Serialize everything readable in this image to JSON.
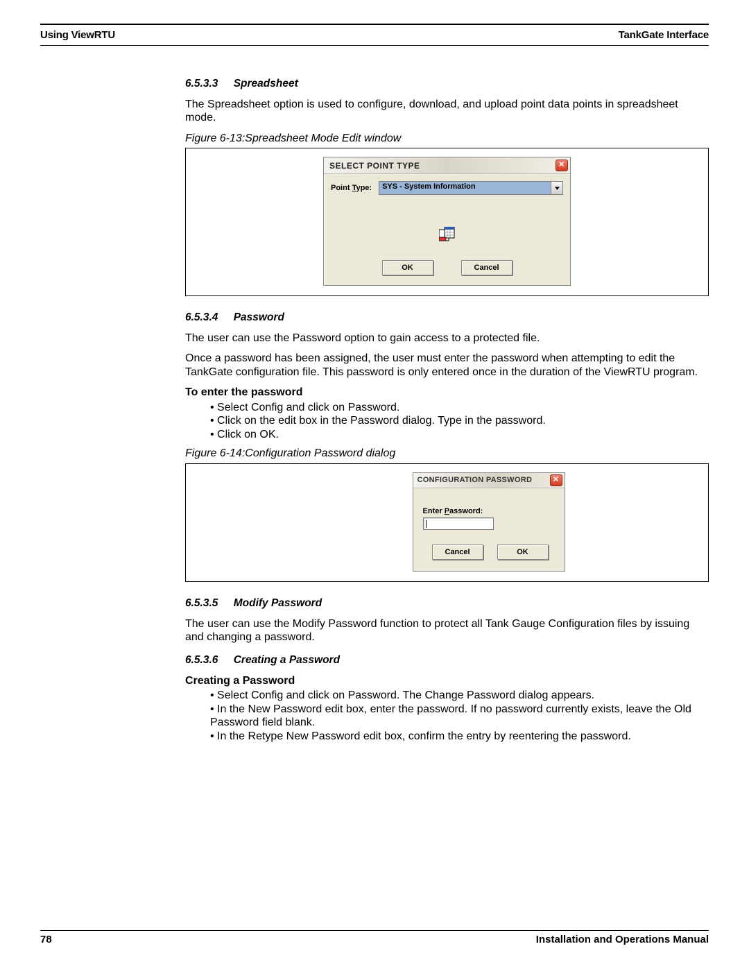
{
  "header": {
    "left": "Using ViewRTU",
    "right": "TankGate Interface"
  },
  "s6533": {
    "num": "6.5.3.3",
    "title": "Spreadsheet",
    "para": "The Spreadsheet option is used to configure, download, and upload point data points in spreadsheet mode.",
    "caption": "Figure 6-13:Spreadsheet Mode Edit window"
  },
  "dlg1": {
    "title": "SELECT POINT TYPE",
    "label_pre": "Point ",
    "label_ul": "T",
    "label_post": "ype:",
    "value": "SYS - System Information",
    "ok": "OK",
    "cancel": "Cancel"
  },
  "s6534": {
    "num": "6.5.3.4",
    "title": "Password",
    "para1": "The user can use the Password option to gain access to a protected file.",
    "para2": "Once a password has been assigned, the user must enter the password when attempting to edit the TankGate configuration file. This password is only entered once in the duration of the ViewRTU program.",
    "subhead": "To enter the password",
    "b1": "Select Config and click on Password.",
    "b2": "Click on the edit box in the Password dialog. Type in the password.",
    "b3": "Click on OK.",
    "caption": "Figure 6-14:Configuration Password dialog"
  },
  "dlg2": {
    "title": "CONFIGURATION PASSWORD",
    "label_pre": "Enter ",
    "label_ul": "P",
    "label_post": "assword:",
    "cancel": "Cancel",
    "ok": "OK"
  },
  "s6535": {
    "num": "6.5.3.5",
    "title": "Modify Password",
    "para": "The user can use the Modify Password function to protect all Tank Gauge Configuration files by issuing and changing a password."
  },
  "s6536": {
    "num": "6.5.3.6",
    "title": "Creating a Password",
    "subhead": "Creating a Password",
    "b1": "Select Config and click on Password. The Change Password dialog appears.",
    "b2": "In the New Password edit box, enter the password. If no password currently exists, leave the Old Password field blank.",
    "b3": "In the Retype New Password edit box, confirm the entry by reentering the password."
  },
  "footer": {
    "page": "78",
    "manual": "Installation and Operations Manual"
  }
}
